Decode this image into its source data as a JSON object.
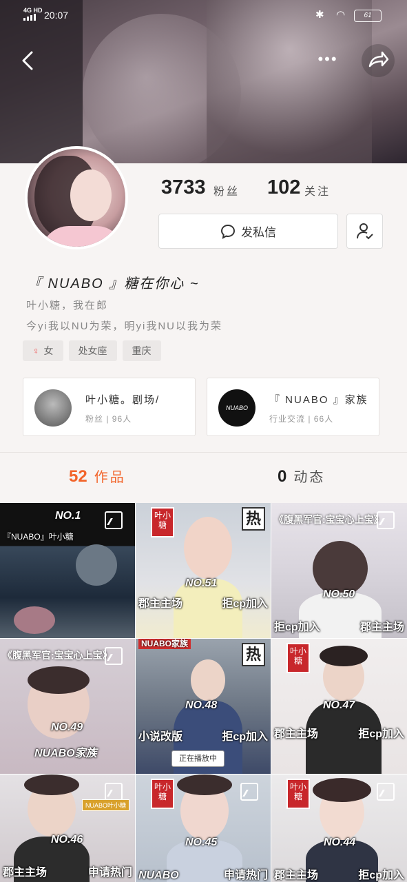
{
  "status_bar": {
    "network": "4G HD",
    "time": "20:07",
    "battery": "61"
  },
  "profile": {
    "followers_count": "3733",
    "followers_label": "粉丝",
    "following_count": "102",
    "following_label": "关注",
    "dm_label": "发私信",
    "nickname": "『 NUABO 』糖在你心 ~",
    "bio_line1": "叶小糖，我在郎",
    "bio_line2": "今yi我以NU为荣，明yi我NU以我为荣",
    "tags": [
      "女",
      "处女座",
      "重庆"
    ]
  },
  "cards": [
    {
      "title": "叶小糖。剧场/",
      "sub": "粉丝 | 96人"
    },
    {
      "title": "『 NUABO 』家族",
      "sub": "行业交流 | 66人",
      "thumb_text": "NUABO"
    }
  ],
  "tabs": {
    "works_count": "52",
    "works_label": "作品",
    "dynamic_count": "0",
    "dynamic_label": "动态"
  },
  "tiles": [
    {
      "no": "NO.1",
      "title": "『NUABO』叶小糖"
    },
    {
      "no": "NO.51",
      "left": "郡主主场",
      "right": "拒cp加入",
      "stamp": "叶小糖",
      "hot": "热"
    },
    {
      "no": "NO.50",
      "title": "《腹黑军官:宝宝心上宝》",
      "left": "拒cp加入",
      "right": "郡主主场"
    },
    {
      "no": "NO.49",
      "title": "《腹黑军官:宝宝心上宝》",
      "bottom": "NUABO家族"
    },
    {
      "no": "NO.48",
      "left": "小说改版",
      "right": "拒cp加入",
      "playing": "正在播放中",
      "hot": "热",
      "top_tag": "NUABO家族"
    },
    {
      "no": "NO.47",
      "left": "郡主主场",
      "right": "拒cp加入",
      "stamp": "叶小糖"
    },
    {
      "no": "NO.46",
      "left": "郡主主场",
      "right": "申请热门",
      "label": "NUABO叶小糖"
    },
    {
      "no": "NO.45",
      "left": "NUABO",
      "right": "申请热门",
      "stamp": "叶小糖"
    },
    {
      "no": "NO.44",
      "left": "郡主主场",
      "right": "拒cp加入",
      "stamp": "叶小糖"
    }
  ]
}
